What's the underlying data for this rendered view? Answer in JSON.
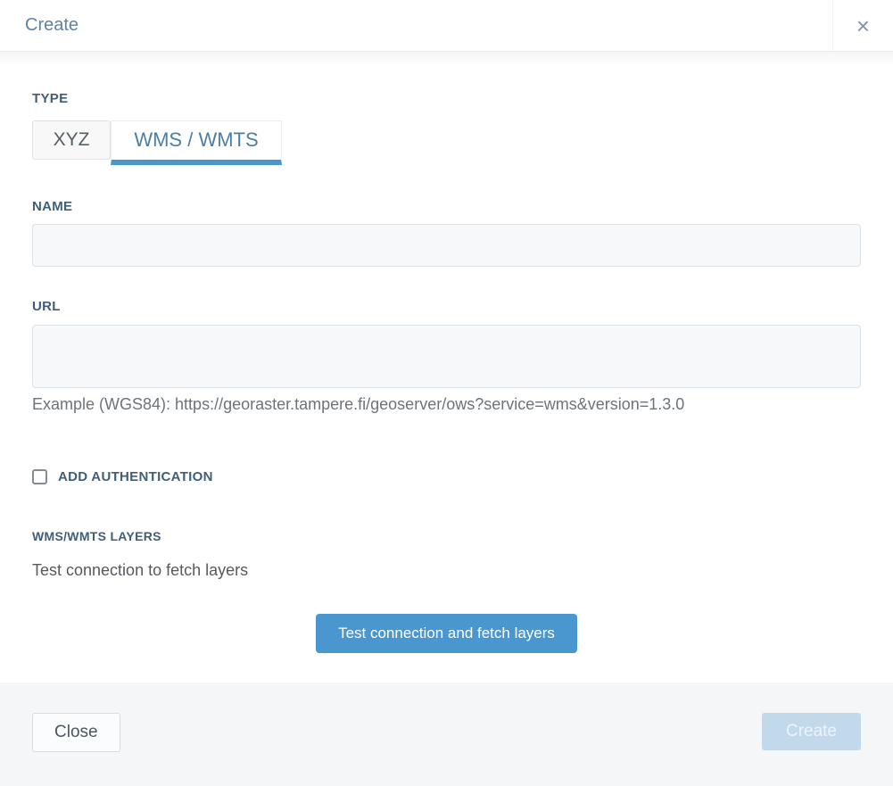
{
  "modal": {
    "title": "Create",
    "close_icon": "×"
  },
  "form": {
    "type": {
      "label": "TYPE",
      "tabs": [
        {
          "label": "XYZ",
          "active": false
        },
        {
          "label": "WMS / WMTS",
          "active": true
        }
      ]
    },
    "name": {
      "label": "NAME",
      "value": "",
      "placeholder": ""
    },
    "url": {
      "label": "URL",
      "value": "",
      "placeholder": "",
      "example": "Example (WGS84): https://georaster.tampere.fi/geoserver/ows?service=wms&version=1.3.0"
    },
    "auth": {
      "label": "ADD AUTHENTICATION",
      "checked": false
    },
    "layers": {
      "label": "WMS/WMTS LAYERS",
      "hint": "Test connection to fetch layers",
      "test_button_label": "Test connection and fetch layers"
    }
  },
  "footer": {
    "close_label": "Close",
    "create_label": "Create",
    "create_disabled": true
  },
  "colors": {
    "accent_blue": "#4a96ce",
    "tab_underline_blue": "#4a96c8",
    "label_blue_gray": "#3f5e79",
    "title_blue_gray": "#5f82a2",
    "disabled_create_bg": "#c2d9ec",
    "footer_bg": "#f4f6f8",
    "input_bg": "#f7f8fa"
  }
}
